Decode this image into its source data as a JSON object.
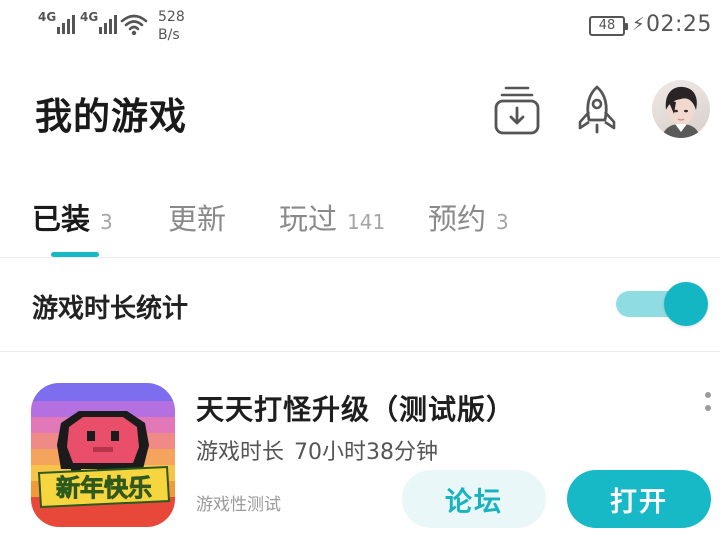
{
  "status_bar": {
    "signal1_label": "4G",
    "signal2_label": "4G",
    "net_speed_value": "528",
    "net_speed_unit": "B/s",
    "battery": "48",
    "time": "02:25"
  },
  "header": {
    "title": "我的游戏",
    "icons": [
      "download-manager-icon",
      "rocket-icon"
    ],
    "avatar": "user-avatar"
  },
  "tabs": [
    {
      "label": "已装",
      "count": "3",
      "active": true
    },
    {
      "label": "更新",
      "count": "",
      "active": false
    },
    {
      "label": "玩过",
      "count": "141",
      "active": false
    },
    {
      "label": "预约",
      "count": "3",
      "active": false
    }
  ],
  "playtime_stats": {
    "label": "游戏时长统计",
    "enabled": true
  },
  "game": {
    "name": "天天打怪升级（测试版）",
    "playtime_label": "游戏时长",
    "playtime_value": "70小时38分钟",
    "tag": "游戏性测试",
    "icon_caption": "新年快乐",
    "forum_button": "论坛",
    "open_button": "打开"
  },
  "colors": {
    "accent": "#17b9c6",
    "accent_light": "#e9f7f8",
    "toggle_track": "#8fdde3"
  }
}
